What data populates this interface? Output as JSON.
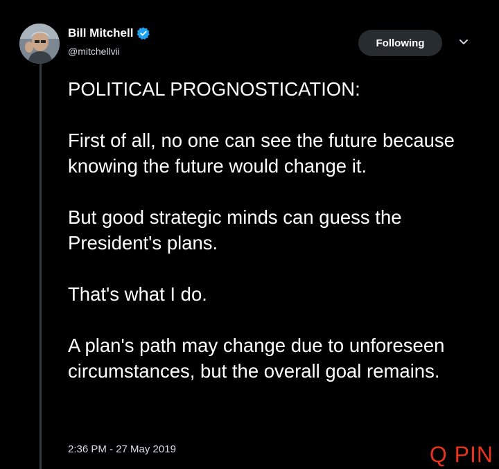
{
  "user": {
    "display_name": "Bill Mitchell",
    "handle": "@mitchellvii",
    "verified": true
  },
  "follow_button": {
    "label": "Following"
  },
  "tweet": {
    "paragraphs": [
      "POLITICAL PROGNOSTICATION:",
      "First of all, no one can see the future because knowing the future would change it.",
      "But good strategic minds can guess the President's plans.",
      "That's what I do.",
      "A plan's path may change due to unforeseen circumstances, but the overall goal remains."
    ],
    "timestamp": "2:36 PM - 27 May 2019"
  },
  "watermark": {
    "text": "Q PIN"
  },
  "colors": {
    "background": "#000000",
    "verified_badge": "#1da1f2",
    "watermark": "#e8341f",
    "button_bg": "#272c31"
  },
  "icons": {
    "verified": "verified-badge-icon",
    "caret": "chevron-down-icon"
  }
}
